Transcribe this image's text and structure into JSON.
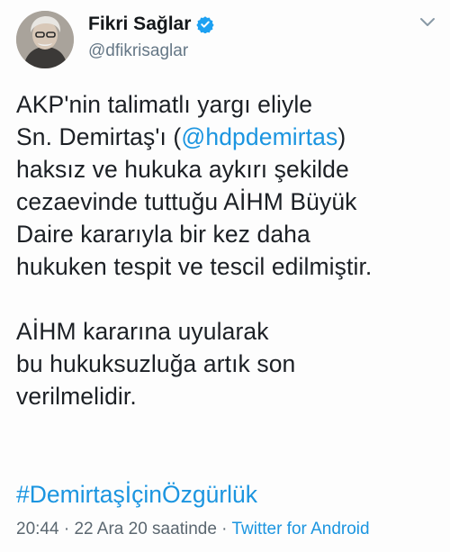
{
  "author": {
    "display_name": "Fikri Sağlar",
    "handle": "@dfikrisaglar",
    "verified": true
  },
  "tweet": {
    "paragraph1": [
      "AKP'nin talimatlı yargı eliyle",
      [
        "Sn. Demirtaş'ı (",
        "@hdpdemirtas",
        ")"
      ],
      "haksız ve hukuka aykırı şekilde",
      "cezaevinde tuttuğu AİHM Büyük",
      "Daire kararıyla bir kez daha",
      "hukuken tespit ve tescil edilmiştir."
    ],
    "paragraph2": [
      "AİHM kararına uyularak",
      "bu hukuksuzluğa artık son",
      "verilmelidir."
    ],
    "hashtag": "#DemirtaşİçinÖzgürlük"
  },
  "meta": {
    "time": "20:44",
    "date": "22 Ara 20 saatinde",
    "separator": " · ",
    "source": "Twitter for Android"
  },
  "icons": {
    "verified": "verified-badge-icon",
    "menu": "chevron-down-icon"
  },
  "colors": {
    "link": "#1b95e0",
    "secondary_text": "#657786",
    "verified": "#1da1f2"
  }
}
